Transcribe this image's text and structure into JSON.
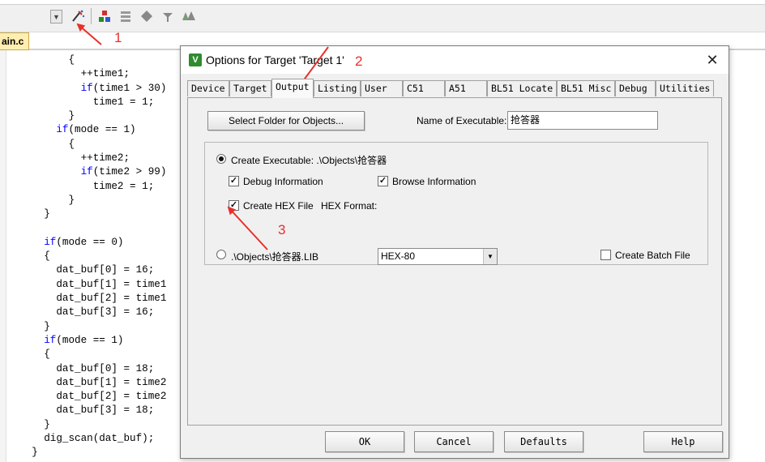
{
  "toolbar": {
    "icons": [
      "dropdown-arrow-icon",
      "magic-wand-icon",
      "target-options-icon",
      "manage-components-icon",
      "diamond-icon",
      "pin-icon",
      "books-icon"
    ]
  },
  "editor": {
    "file_tab": "ain.c",
    "code_lines": [
      {
        "indent": "        ",
        "kw": "",
        "text": "{"
      },
      {
        "indent": "          ",
        "kw": "",
        "text": "++time1;"
      },
      {
        "indent": "          ",
        "kw": "if",
        "text": "(time1 > 30)"
      },
      {
        "indent": "            ",
        "kw": "",
        "text": "time1 = 1;"
      },
      {
        "indent": "        ",
        "kw": "",
        "text": "}"
      },
      {
        "indent": "      ",
        "kw": "if",
        "text": "(mode == 1)"
      },
      {
        "indent": "        ",
        "kw": "",
        "text": "{"
      },
      {
        "indent": "          ",
        "kw": "",
        "text": "++time2;"
      },
      {
        "indent": "          ",
        "kw": "if",
        "text": "(time2 > 99)"
      },
      {
        "indent": "            ",
        "kw": "",
        "text": "time2 = 1;"
      },
      {
        "indent": "        ",
        "kw": "",
        "text": "}"
      },
      {
        "indent": "    ",
        "kw": "",
        "text": "}"
      },
      {
        "indent": "",
        "kw": "",
        "text": ""
      },
      {
        "indent": "    ",
        "kw": "if",
        "text": "(mode == 0)"
      },
      {
        "indent": "    ",
        "kw": "",
        "text": "{"
      },
      {
        "indent": "      ",
        "kw": "",
        "text": "dat_buf[0] = 16;"
      },
      {
        "indent": "      ",
        "kw": "",
        "text": "dat_buf[1] = time1"
      },
      {
        "indent": "      ",
        "kw": "",
        "text": "dat_buf[2] = time1"
      },
      {
        "indent": "      ",
        "kw": "",
        "text": "dat_buf[3] = 16;"
      },
      {
        "indent": "    ",
        "kw": "",
        "text": "}"
      },
      {
        "indent": "    ",
        "kw": "if",
        "text": "(mode == 1)"
      },
      {
        "indent": "    ",
        "kw": "",
        "text": "{"
      },
      {
        "indent": "      ",
        "kw": "",
        "text": "dat_buf[0] = 18;"
      },
      {
        "indent": "      ",
        "kw": "",
        "text": "dat_buf[1] = time2"
      },
      {
        "indent": "      ",
        "kw": "",
        "text": "dat_buf[2] = time2"
      },
      {
        "indent": "      ",
        "kw": "",
        "text": "dat_buf[3] = 18;"
      },
      {
        "indent": "    ",
        "kw": "",
        "text": "}"
      },
      {
        "indent": "    ",
        "kw": "",
        "text": "dig_scan(dat_buf);"
      },
      {
        "indent": "  ",
        "kw": "",
        "text": "}"
      }
    ]
  },
  "dialog": {
    "title": "Options for Target 'Target 1'",
    "close_glyph": "✕",
    "tabs": [
      "Device",
      "Target",
      "Output",
      "Listing",
      "User",
      "C51",
      "A51",
      "BL51 Locate",
      "BL51 Misc",
      "Debug",
      "Utilities"
    ],
    "active_tab": "Output",
    "output": {
      "select_folder_button": "Select Folder for Objects...",
      "name_of_executable_label": "Name of Executable:",
      "name_of_executable_value": "抢答器",
      "create_executable_label": "Create Executable:  .\\Objects\\抢答器",
      "create_executable_checked": true,
      "debug_information_label": "Debug Information",
      "debug_information_checked": true,
      "browse_information_label": "Browse Information",
      "browse_information_checked": true,
      "create_hex_label": "Create HEX File",
      "create_hex_checked": true,
      "hex_format_label": "HEX Format:",
      "hex_format_value": "HEX-80",
      "create_library_label": ".\\Objects\\抢答器.LIB",
      "create_library_checked": false,
      "create_batch_label": "Create Batch File",
      "create_batch_checked": false
    },
    "footer": {
      "ok": "OK",
      "cancel": "Cancel",
      "defaults": "Defaults",
      "help": "Help"
    }
  },
  "annotations": {
    "color": "#e8302a",
    "labels": [
      "1",
      "2",
      "3"
    ]
  }
}
